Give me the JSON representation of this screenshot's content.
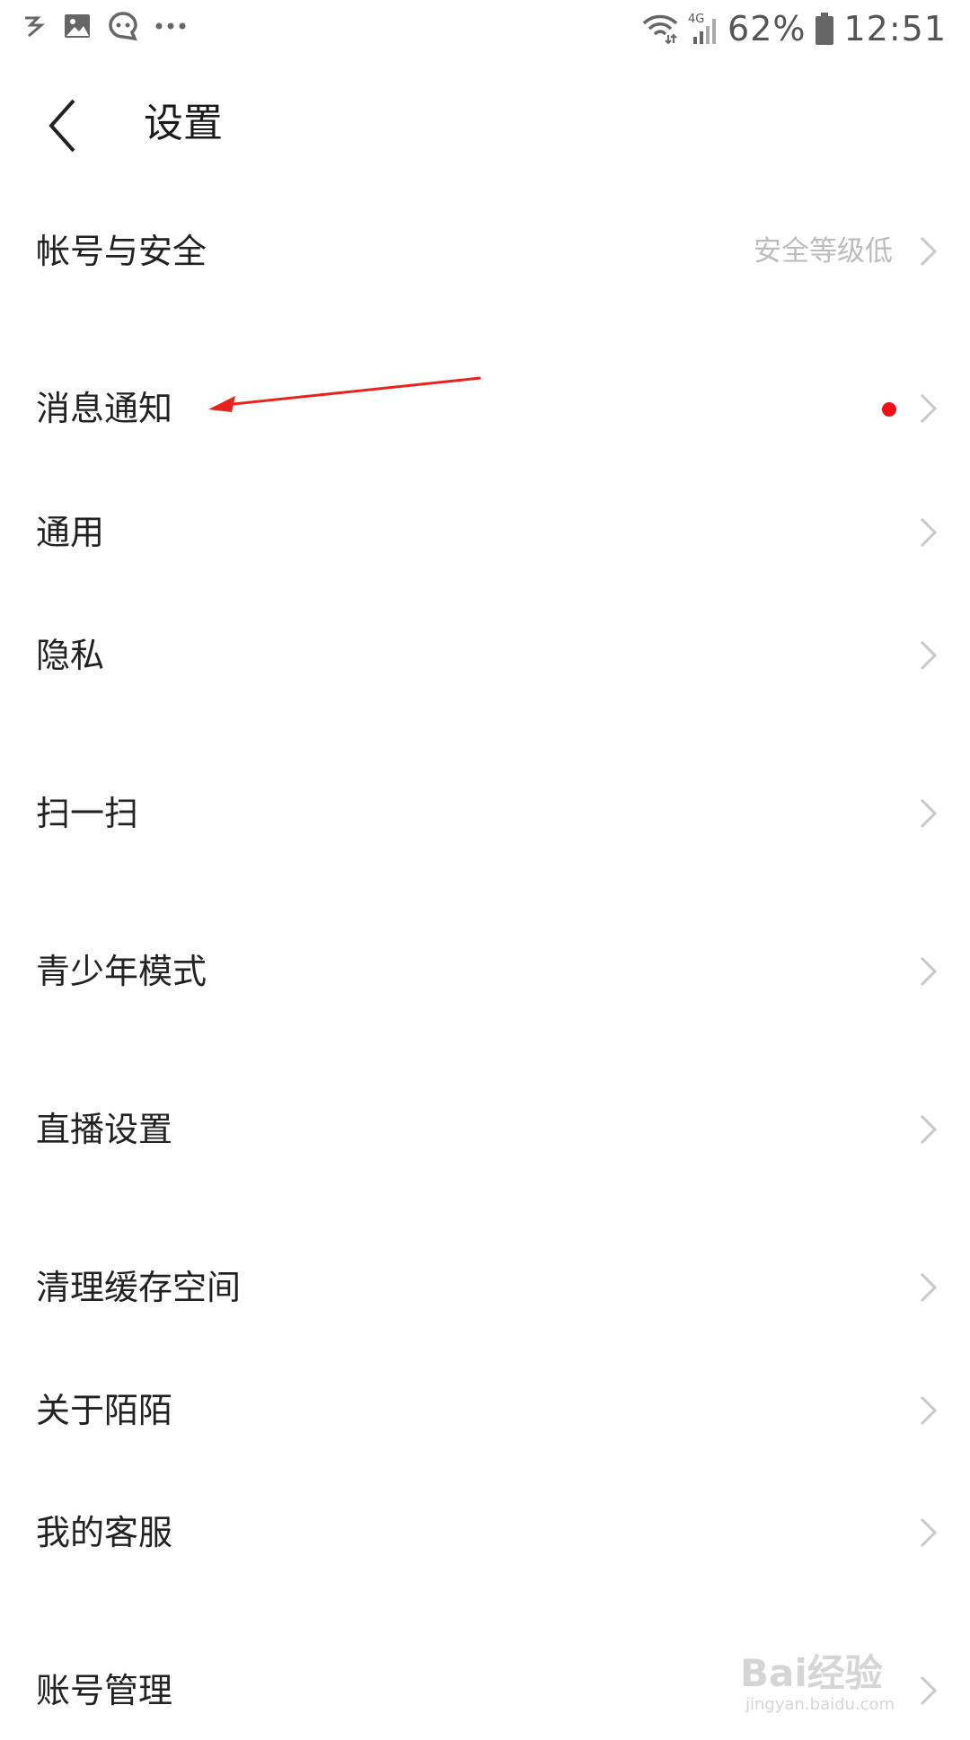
{
  "status_bar": {
    "left_icons": [
      "app-icon",
      "gallery-icon",
      "chat-icon",
      "more-dots-icon"
    ],
    "net_label": "4G",
    "battery": "62%",
    "time": "12:51"
  },
  "header": {
    "back_icon": "chevron-left-icon",
    "title": "设置"
  },
  "settings": {
    "account_security": {
      "label": "帐号与安全",
      "value": "安全等级低"
    },
    "notifications": {
      "label": "消息通知",
      "has_red_dot": true
    },
    "general": {
      "label": "通用"
    },
    "privacy": {
      "label": "隐私"
    },
    "scan": {
      "label": "扫一扫"
    },
    "teen_mode": {
      "label": "青少年模式"
    },
    "live_settings": {
      "label": "直播设置"
    },
    "clear_cache": {
      "label": "清理缓存空间"
    },
    "about": {
      "label": "关于陌陌"
    },
    "customer_service": {
      "label": "我的客服"
    },
    "account_manage": {
      "label": "账号管理"
    }
  },
  "colors": {
    "accent_red": "#f20f15",
    "secondary_text": "#bcbcbc",
    "chevron": "#c8c8c8"
  },
  "watermark": {
    "main": "Bai经验",
    "sub": "jingyan.baidu.com"
  }
}
